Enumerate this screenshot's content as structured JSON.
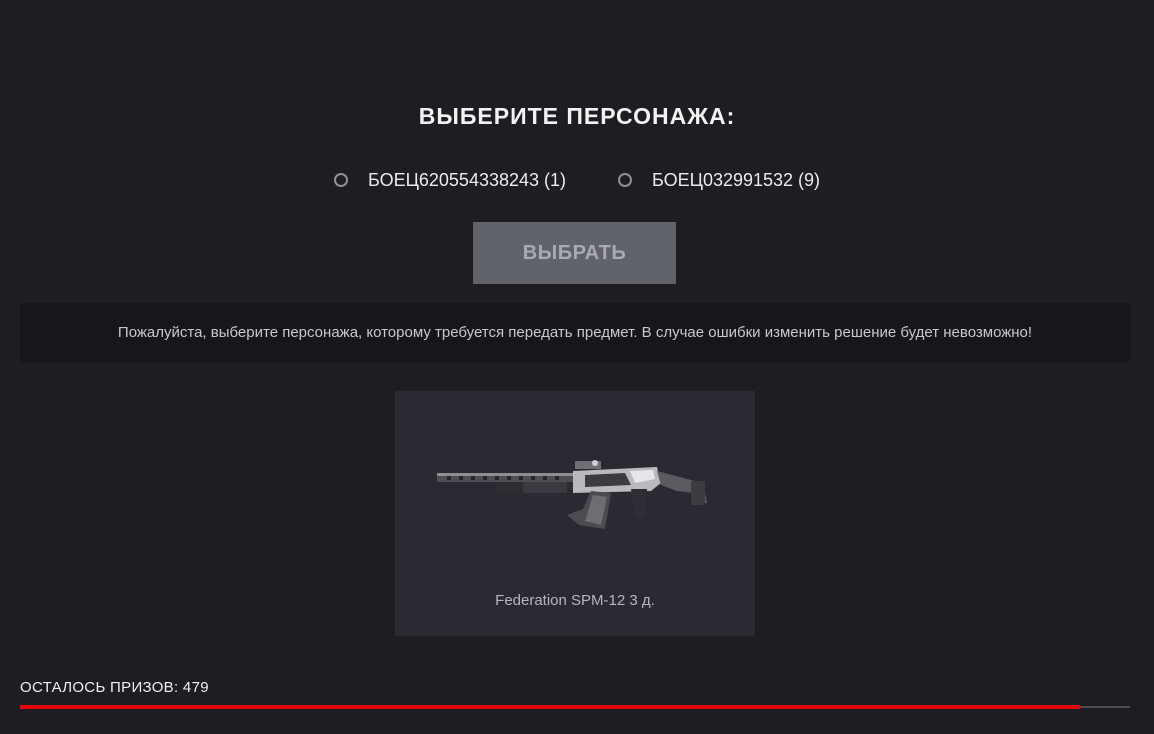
{
  "title": "ВЫБЕРИТЕ ПЕРСОНАЖА:",
  "characters": [
    {
      "label": "БОЕЦ620554338243 (1)",
      "selected": false
    },
    {
      "label": "БОЕЦ032991532 (9)",
      "selected": false
    }
  ],
  "select_button": {
    "label": "ВЫБРАТЬ"
  },
  "notice": "Пожалуйста, выберите персонажа, которому требуется передать предмет. В случае ошибки изменить решение будет невозможно!",
  "item": {
    "name": "Federation SPM-12 3 д.",
    "icon": "shotgun-image"
  },
  "prizes": {
    "label": "ОСТАЛОСЬ ПРИЗОВ: 479",
    "progress": 0.955
  },
  "colors": {
    "background": "#1d1d22",
    "accent": "#e3060b",
    "button": "#60636a",
    "card": "#2a2b32"
  }
}
